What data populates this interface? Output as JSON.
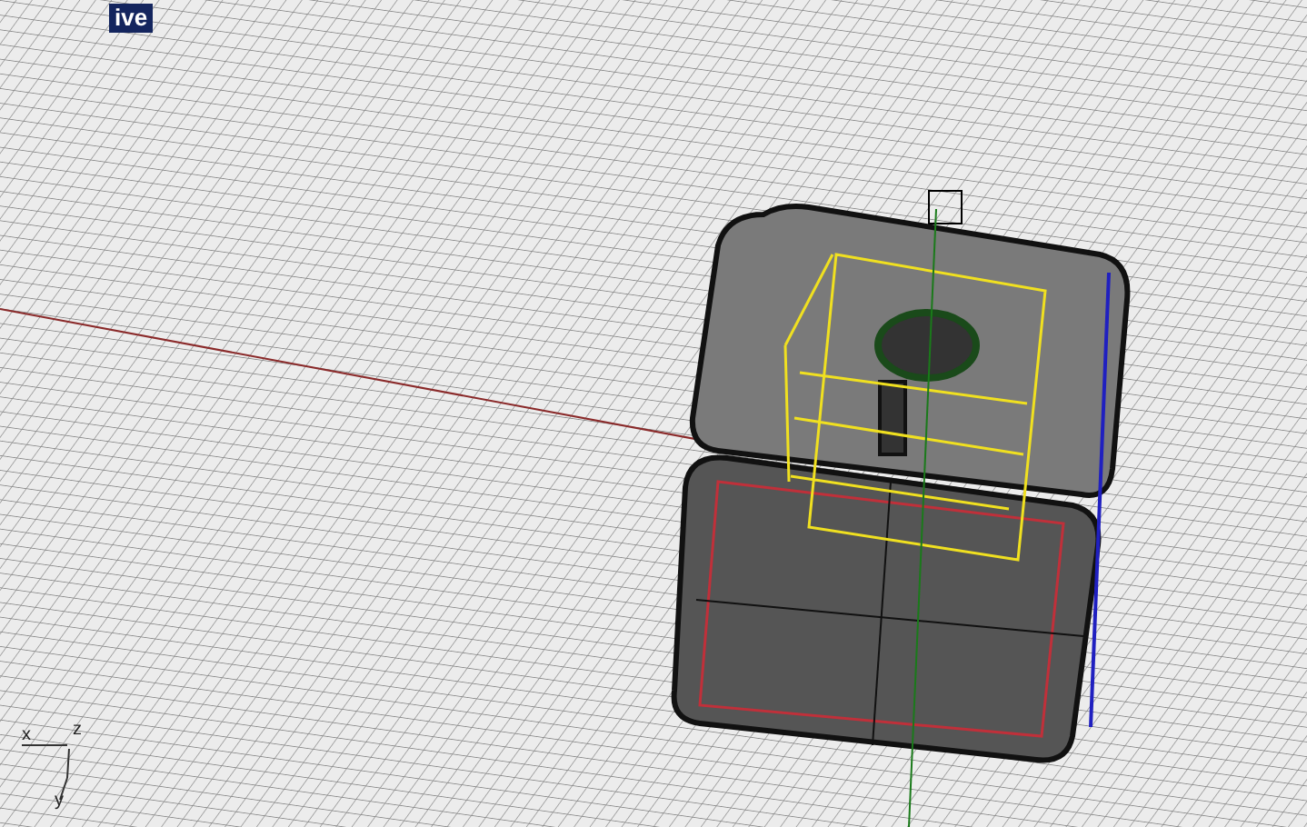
{
  "viewport": {
    "label": "ive",
    "axes": [
      {
        "kind": "x",
        "label": "x"
      },
      {
        "kind": "y",
        "label": "y"
      },
      {
        "kind": "z",
        "label": "z"
      }
    ]
  }
}
